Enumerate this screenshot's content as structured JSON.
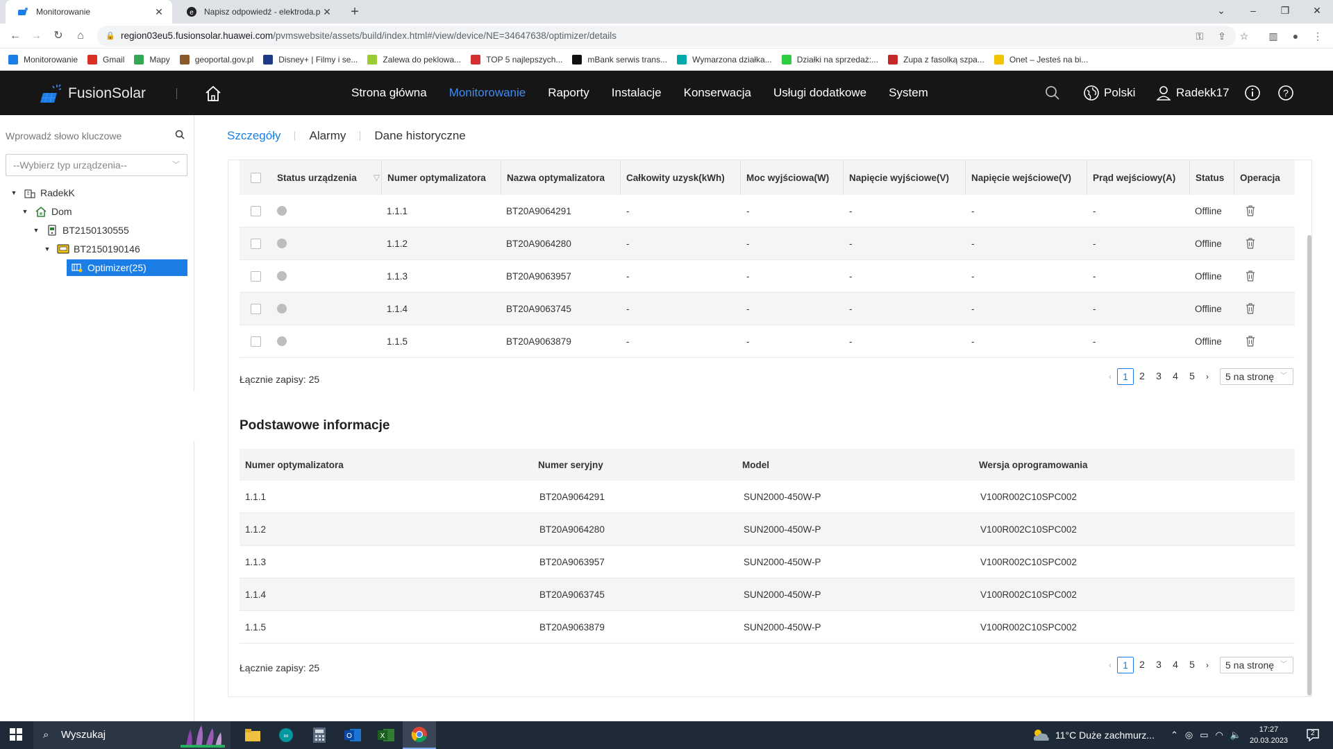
{
  "browser": {
    "tabs": [
      {
        "title": "Monitorowanie",
        "icon": "fusionsolar-icon"
      },
      {
        "title": "Napisz odpowiedź - elektroda.pl",
        "icon": "elektroda-icon"
      }
    ],
    "url_host": "region03eu5.fusionsolar.huawei.com",
    "url_path": "/pvmswebsite/assets/build/index.html#/view/device/NE=34647638/optimizer/details",
    "bookmarks": [
      {
        "label": "Monitorowanie",
        "color": "#1a7ee6"
      },
      {
        "label": "Gmail",
        "color": "#d93025"
      },
      {
        "label": "Mapy",
        "color": "#34a853"
      },
      {
        "label": "geoportal.gov.pl",
        "color": "#8a5a2b"
      },
      {
        "label": "Disney+ | Filmy i se...",
        "color": "#1e3a8a"
      },
      {
        "label": "Zalewa do peklowa...",
        "color": "#9acd32"
      },
      {
        "label": "TOP 5 najlepszych...",
        "color": "#d32f2f"
      },
      {
        "label": "mBank serwis trans...",
        "color": "#111111"
      },
      {
        "label": "Wymarzona działka...",
        "color": "#00a8a8"
      },
      {
        "label": "Działki na sprzedaż:...",
        "color": "#2ecc40"
      },
      {
        "label": "Zupa z fasolką szpa...",
        "color": "#c62828"
      },
      {
        "label": "Onet – Jesteś na bi...",
        "color": "#f5c400"
      }
    ]
  },
  "header": {
    "brand": "FusionSolar",
    "menu": [
      "Strona główna",
      "Monitorowanie",
      "Raporty",
      "Instalacje",
      "Konserwacja",
      "Usługi dodatkowe",
      "System"
    ],
    "active_menu": "Monitorowanie",
    "language": "Polski",
    "user": "Radekk17",
    "accent": "#3d8cf5"
  },
  "sidebar": {
    "search_placeholder": "Wprowadź słowo kluczowe",
    "device_type_placeholder": "--Wybierz typ urządzenia--",
    "tree": [
      {
        "label": "RadekK",
        "icon": "company-icon"
      },
      {
        "label": "Dom",
        "icon": "home-plant-icon"
      },
      {
        "label": "BT2150130555",
        "icon": "inverter-icon"
      },
      {
        "label": "BT2150190146",
        "icon": "logger-icon"
      },
      {
        "label": "Optimizer(25)",
        "icon": "optimizer-icon"
      }
    ]
  },
  "subtabs": [
    "Szczegóły",
    "Alarmy",
    "Dane historyczne"
  ],
  "details_table": {
    "headers": [
      "Status urządzenia",
      "Numer optymalizatora",
      "Nazwa optymalizatora",
      "Całkowity uzysk(kWh)",
      "Moc wyjściowa(W)",
      "Napięcie wyjściowe(V)",
      "Napięcie wejściowe(V)",
      "Prąd wejściowy(A)",
      "Status",
      "Operacja"
    ],
    "rows": [
      {
        "num": "1.1.1",
        "name": "BT20A9064291",
        "yield": "-",
        "power": "-",
        "vout": "-",
        "vin": "-",
        "iin": "-",
        "status": "Offline"
      },
      {
        "num": "1.1.2",
        "name": "BT20A9064280",
        "yield": "-",
        "power": "-",
        "vout": "-",
        "vin": "-",
        "iin": "-",
        "status": "Offline"
      },
      {
        "num": "1.1.3",
        "name": "BT20A9063957",
        "yield": "-",
        "power": "-",
        "vout": "-",
        "vin": "-",
        "iin": "-",
        "status": "Offline"
      },
      {
        "num": "1.1.4",
        "name": "BT20A9063745",
        "yield": "-",
        "power": "-",
        "vout": "-",
        "vin": "-",
        "iin": "-",
        "status": "Offline"
      },
      {
        "num": "1.1.5",
        "name": "BT20A9063879",
        "yield": "-",
        "power": "-",
        "vout": "-",
        "vin": "-",
        "iin": "-",
        "status": "Offline"
      }
    ],
    "total": "Łącznie zapisy: 25"
  },
  "basic_info": {
    "title": "Podstawowe informacje",
    "headers": [
      "Numer optymalizatora",
      "Numer seryjny",
      "Model",
      "Wersja oprogramowania"
    ],
    "rows": [
      [
        "1.1.1",
        "BT20A9064291",
        "SUN2000-450W-P",
        "V100R002C10SPC002"
      ],
      [
        "1.1.2",
        "BT20A9064280",
        "SUN2000-450W-P",
        "V100R002C10SPC002"
      ],
      [
        "1.1.3",
        "BT20A9063957",
        "SUN2000-450W-P",
        "V100R002C10SPC002"
      ],
      [
        "1.1.4",
        "BT20A9063745",
        "SUN2000-450W-P",
        "V100R002C10SPC002"
      ],
      [
        "1.1.5",
        "BT20A9063879",
        "SUN2000-450W-P",
        "V100R002C10SPC002"
      ]
    ],
    "total": "Łącznie zapisy: 25"
  },
  "pagination": {
    "pages": [
      "1",
      "2",
      "3",
      "4",
      "5"
    ],
    "current": "1",
    "per_page": "5 na stronę"
  },
  "taskbar": {
    "search": "Wyszukaj",
    "weather": "11°C  Duże zachmurz...",
    "time": "17:27",
    "date": "20.03.2023",
    "notifications": "2"
  }
}
